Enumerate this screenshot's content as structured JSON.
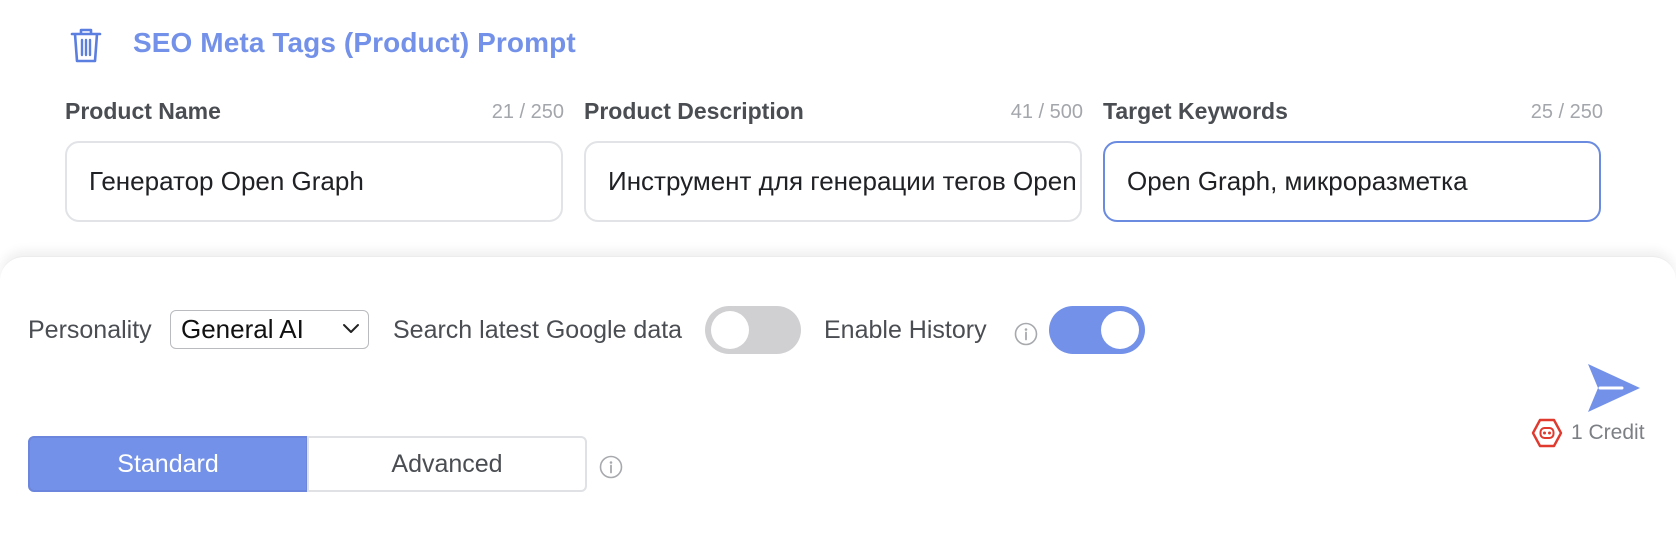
{
  "prompt": {
    "title": "SEO Meta Tags (Product) Prompt"
  },
  "fields": [
    {
      "label": "Product Name",
      "count": "21 / 250",
      "value": "Генератор Open Graph"
    },
    {
      "label": "Product Description",
      "count": "41 / 500",
      "value": "Инструмент для генерации тегов Open Graph"
    },
    {
      "label": "Target Keywords",
      "count": "25 / 250",
      "value": "Open Graph, микроразметка"
    }
  ],
  "options": {
    "personality_label": "Personality",
    "personality_value": "General AI",
    "search_label": "Search latest Google data",
    "search_enabled": false,
    "history_label": "Enable History",
    "history_enabled": true
  },
  "modes": {
    "standard": "Standard",
    "advanced": "Advanced",
    "selected": "Standard"
  },
  "credit": {
    "text": "1 Credit"
  },
  "colors": {
    "accent": "#7391e8",
    "credit_icon": "#e03a2f",
    "toggle_off": "#d0d0d2"
  }
}
